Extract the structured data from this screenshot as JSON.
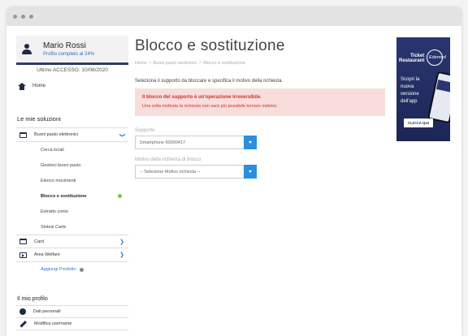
{
  "profile": {
    "name": "Mario Rossi",
    "completion": "Profilo completo al 24%",
    "last_access": "Ultimo ACCESSO: 10/06/2020"
  },
  "sidebar": {
    "home_label": "Home",
    "solutions_title": "Le mie soluzioni",
    "menu": {
      "buoni": "Buoni pasto elettronici",
      "card": "Card",
      "welfare": "Area Welfare"
    },
    "submenu": [
      "Cerca locali",
      "Gestisci buoni pasto",
      "Elenco movimenti",
      "Blocco e sostituzione",
      "Estratto conto",
      "Sintesi Carte"
    ],
    "add_product": "Aggiungi Prodotto",
    "profile_title": "Il mio profilo",
    "profile_menu": {
      "personal": "Dati personali",
      "username": "Modifica username"
    }
  },
  "main": {
    "title": "Blocco e sostituzione",
    "breadcrumb": {
      "home": "Home",
      "sep": "/",
      "section": "Buoni pasto elettronici",
      "current": "Blocco e sostituzione"
    },
    "instructions": "Seleziona il supporto da bloccare e specifica il motivo della richiesta.",
    "alert": {
      "title": "Il blocco del supporto è un'operazione irreversibile.",
      "text": "Una volta inoltrata la richiesta non sarà più possibile tornare indietro."
    },
    "support_label": "Supporto",
    "support_value": "Smartphone 60000417",
    "reason_label": "Motivo della richiesta di blocco",
    "reason_value": "-- Selezione Motivo richiesta --"
  },
  "ad": {
    "brand_line1": "Ticket",
    "brand_line2": "Restaurant",
    "brand_partner": "Edenred",
    "text": "Scopri la nuova versione dell'app",
    "cta": "CLICCA QUI"
  },
  "colors": {
    "accent": "#2b8fe0",
    "navy": "#1f2a44",
    "alert_bg": "#f9dddd",
    "alert_text": "#c0392b",
    "active_dot": "#7fc241"
  }
}
